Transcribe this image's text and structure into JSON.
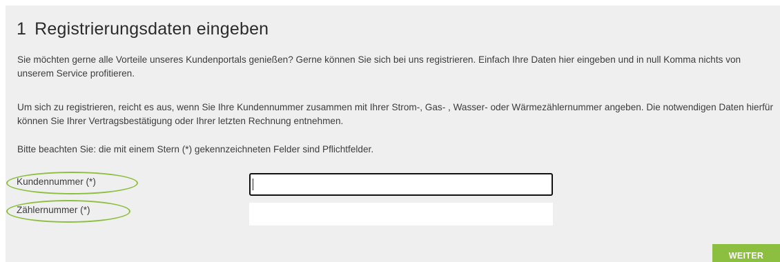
{
  "form": {
    "step_number": "1",
    "title": "Registrierungsdaten eingeben",
    "intro_text": "Sie möchten gerne alle Vorteile unseres Kundenportals genießen? Gerne können Sie sich bei uns registrieren. Einfach Ihre Daten hier eingeben und in null Komma nichts von unserem Service profitieren.",
    "instruction_text": "Um sich zu registrieren, reicht es aus, wenn Sie Ihre Kundennummer zusammen mit Ihrer Strom-, Gas- , Wasser- oder Wärmezählernummer angeben. Die notwendigen Daten hierfür können Sie Ihrer Vertragsbestätigung oder Ihrer letzten Rechnung entnehmen.",
    "required_note": "Bitte beachten Sie: die mit einem Stern (*) gekennzeichneten Felder sind Pflichtfelder.",
    "fields": [
      {
        "label": "Kundennummer (*)",
        "value": "",
        "focused": true
      },
      {
        "label": "Zählernummer (*)",
        "value": "",
        "focused": false
      }
    ],
    "submit_label": "WEITER"
  },
  "colors": {
    "accent_green": "#8cbf3f",
    "panel_background": "#efefef",
    "text": "#3c3c3c"
  }
}
